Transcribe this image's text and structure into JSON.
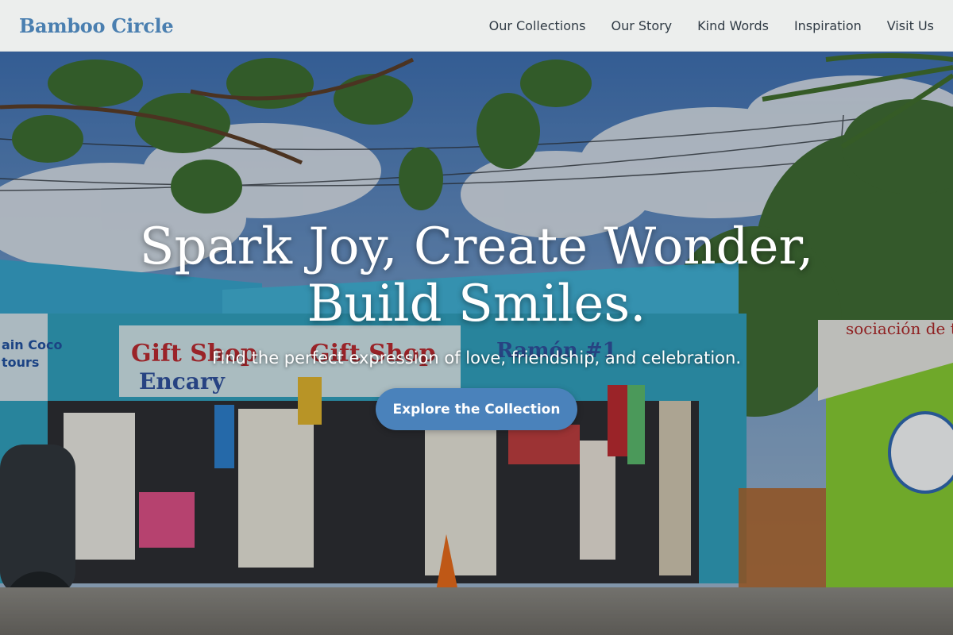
{
  "brand": {
    "name": "Bamboo Circle"
  },
  "nav": {
    "items": [
      {
        "label": "Our Collections"
      },
      {
        "label": "Our Story"
      },
      {
        "label": "Kind Words"
      },
      {
        "label": "Inspiration"
      },
      {
        "label": "Visit Us"
      }
    ]
  },
  "hero": {
    "headline": "Spark Joy, Create Wonder, Build Smiles.",
    "tagline": "Find the perfect expression of love, friendship, and celebration.",
    "cta_label": "Explore the Collection",
    "background_description_icon": "gift-shop-photo",
    "shop_signs": [
      "Gift Shop",
      "Encary",
      "Gift Shop",
      "Ramón #1",
      "ain Coco",
      "tours",
      "sociación de tr"
    ]
  },
  "colors": {
    "brand": "#4a7fb0",
    "cta": "#4a82bb",
    "header_bg": "#f4f5f4",
    "nav_text": "#2f3a44"
  }
}
